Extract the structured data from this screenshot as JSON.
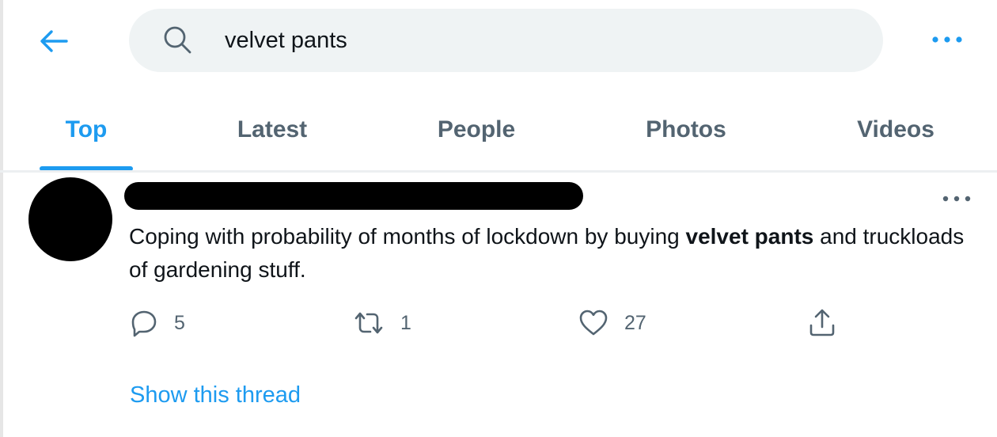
{
  "search": {
    "query": "velvet pants"
  },
  "tabs": [
    {
      "label": "Top",
      "active": true
    },
    {
      "label": "Latest",
      "active": false
    },
    {
      "label": "People",
      "active": false
    },
    {
      "label": "Photos",
      "active": false
    },
    {
      "label": "Videos",
      "active": false
    }
  ],
  "tweet": {
    "text_before": "Coping with probability of months of lockdown by buying ",
    "highlight": "velvet pants",
    "text_after": " and truckloads of gardening stuff.",
    "replies": "5",
    "retweets": "1",
    "likes": "27",
    "show_thread": "Show this thread"
  },
  "colors": {
    "accent": "#1d9bf0",
    "muted": "#536471",
    "search_bg": "#eff3f4"
  },
  "icons": {
    "back": "arrow-left-icon",
    "search": "search-icon",
    "more": "more-horizontal-icon",
    "reply": "reply-icon",
    "retweet": "retweet-icon",
    "like": "heart-icon",
    "share": "share-icon"
  }
}
